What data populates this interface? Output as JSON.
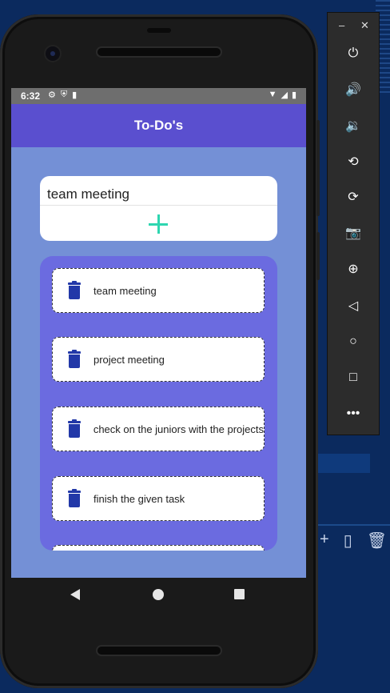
{
  "status_bar": {
    "time": "6:32",
    "left_icons": [
      "gear-icon",
      "shield-icon",
      "sd-card-icon"
    ],
    "right_icons": [
      "wifi-icon",
      "signal-icon",
      "battery-icon"
    ]
  },
  "app": {
    "title": "To-Do's"
  },
  "input": {
    "value": "team meeting"
  },
  "todos": [
    {
      "text": "team meeting"
    },
    {
      "text": "project meeting"
    },
    {
      "text": "check on the juniors with the projects"
    },
    {
      "text": "finish the given task"
    }
  ],
  "colors": {
    "appbar": "#5a4fcf",
    "screen_bg": "#7490d6",
    "list_panel": "#6b6be0",
    "add_button": "#2ed6b0",
    "trash_icon": "#2238a8"
  },
  "emulator_toolbar": {
    "window_controls": [
      "minimize",
      "close"
    ],
    "buttons": [
      "power-icon",
      "volume-up-icon",
      "volume-down-icon",
      "rotate-left-icon",
      "rotate-right-icon",
      "camera-icon",
      "zoom-icon",
      "back-icon",
      "home-icon",
      "overview-icon",
      "more-icon"
    ]
  }
}
